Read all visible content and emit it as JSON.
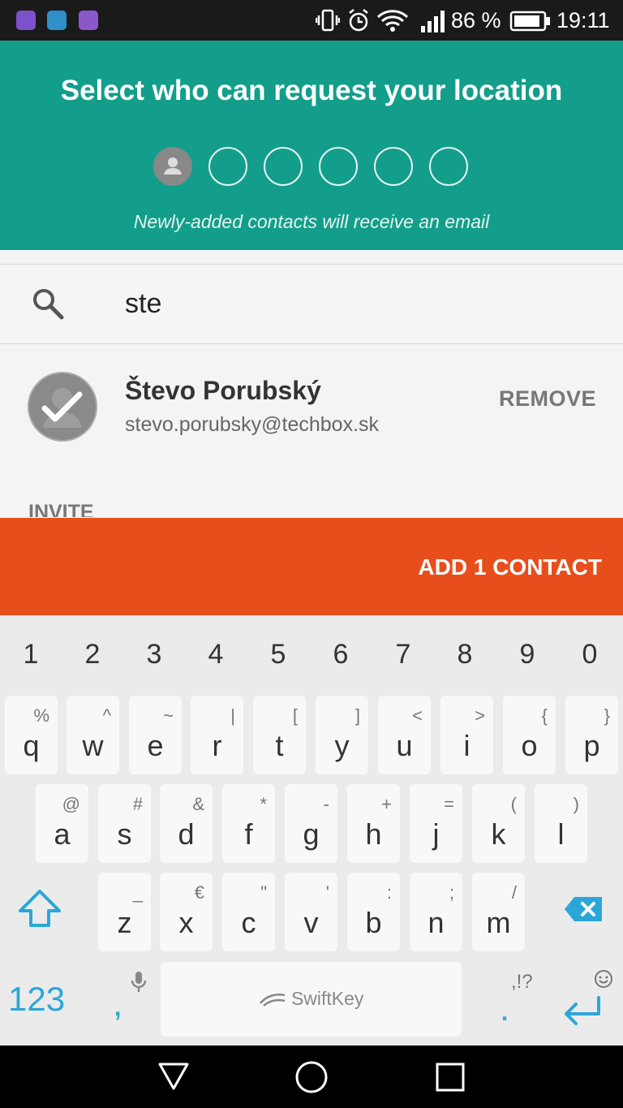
{
  "status_bar": {
    "battery": "86 %",
    "time": "19:11"
  },
  "header": {
    "title": "Select who can request your location",
    "subtitle": "Newly-added contacts will receive an email"
  },
  "search": {
    "query": "ste"
  },
  "contact": {
    "name": "Števo Porubský",
    "email": "stevo.porubsky@techbox.sk",
    "remove_label": "REMOVE"
  },
  "invite_label": "INVITE",
  "add_button": "ADD 1 CONTACT",
  "keyboard": {
    "numbers": [
      "1",
      "2",
      "3",
      "4",
      "5",
      "6",
      "7",
      "8",
      "9",
      "0"
    ],
    "row1": [
      {
        "k": "q",
        "s": "%"
      },
      {
        "k": "w",
        "s": "^"
      },
      {
        "k": "e",
        "s": "~"
      },
      {
        "k": "r",
        "s": "|"
      },
      {
        "k": "t",
        "s": "["
      },
      {
        "k": "y",
        "s": "]"
      },
      {
        "k": "u",
        "s": "<"
      },
      {
        "k": "i",
        "s": ">"
      },
      {
        "k": "o",
        "s": "{"
      },
      {
        "k": "p",
        "s": "}"
      }
    ],
    "row2": [
      {
        "k": "a",
        "s": "@"
      },
      {
        "k": "s",
        "s": "#"
      },
      {
        "k": "d",
        "s": "&"
      },
      {
        "k": "f",
        "s": "*"
      },
      {
        "k": "g",
        "s": "-"
      },
      {
        "k": "h",
        "s": "+"
      },
      {
        "k": "j",
        "s": "="
      },
      {
        "k": "k",
        "s": "("
      },
      {
        "k": "l",
        "s": ")"
      }
    ],
    "row3": [
      {
        "k": "z",
        "s": "_"
      },
      {
        "k": "x",
        "s": "€"
      },
      {
        "k": "c",
        "s": "\""
      },
      {
        "k": "v",
        "s": "'"
      },
      {
        "k": "b",
        "s": ":"
      },
      {
        "k": "n",
        "s": ";"
      },
      {
        "k": "m",
        "s": "/"
      }
    ],
    "mode_key": "123",
    "comma": ",",
    "period": ".",
    "punct_hint": ",!?",
    "brand": "SwiftKey"
  },
  "colors": {
    "header": "#129e8b",
    "accent": "#e84e1b",
    "keyboard_accent": "#2aa7d8"
  }
}
